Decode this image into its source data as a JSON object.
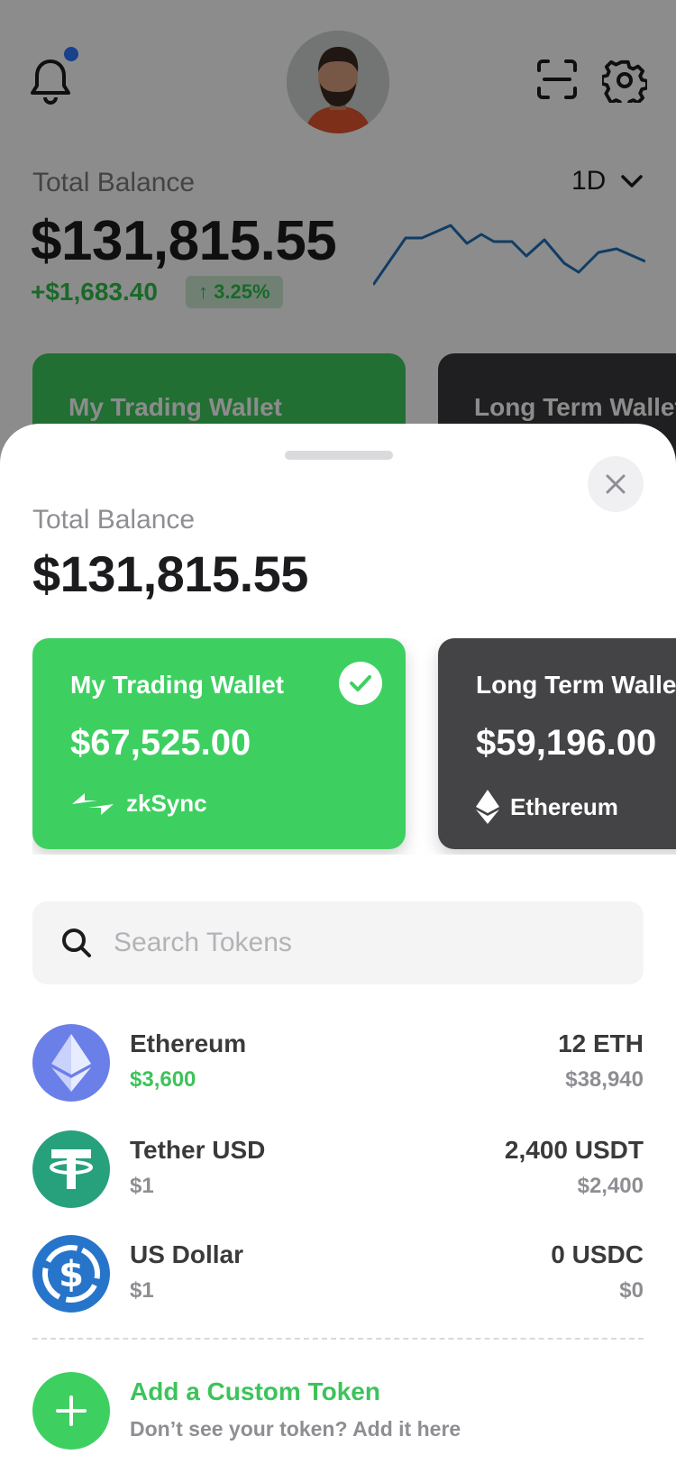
{
  "background": {
    "total_label": "Total Balance",
    "balance": "$131,815.55",
    "change": "+$1,683.40",
    "change_pct": "3.25%",
    "period": "1D",
    "cards": [
      {
        "title": "My Trading Wallet"
      },
      {
        "title": "Long Term Wallet"
      }
    ],
    "icons": {
      "notification": "bell-icon",
      "scan": "scan-icon",
      "settings": "gear-icon",
      "avatar": "user-avatar"
    }
  },
  "sheet": {
    "total_label": "Total Balance",
    "balance": "$131,815.55",
    "wallets": [
      {
        "title": "My Trading Wallet",
        "amount": "$67,525.00",
        "network": "zkSync",
        "selected": true,
        "color": "#3dd061"
      },
      {
        "title": "Long Term Wallet",
        "amount": "$59,196.00",
        "network": "Ethereum",
        "selected": false,
        "color": "#444446"
      }
    ],
    "search": {
      "placeholder": "Search Tokens"
    },
    "tokens": [
      {
        "name": "Ethereum",
        "price": "$3,600",
        "amount": "12 ETH",
        "value": "$38,940",
        "icon": "ethereum-icon",
        "color": "#6b7fe9"
      },
      {
        "name": "Tether USD",
        "price": "$1",
        "amount": "2,400 USDT",
        "value": "$2,400",
        "icon": "tether-icon",
        "color": "#26a17b"
      },
      {
        "name": "US Dollar",
        "price": "$1",
        "amount": "0 USDC",
        "value": "$0",
        "icon": "usdc-icon",
        "color": "#2775ca"
      }
    ],
    "add_token": {
      "title": "Add a Custom Token",
      "subtitle": "Don’t see your token? Add it here"
    }
  },
  "colors": {
    "accent_green": "#3dd061",
    "dark_card": "#444446",
    "sparkline": "#1e6fb8"
  }
}
